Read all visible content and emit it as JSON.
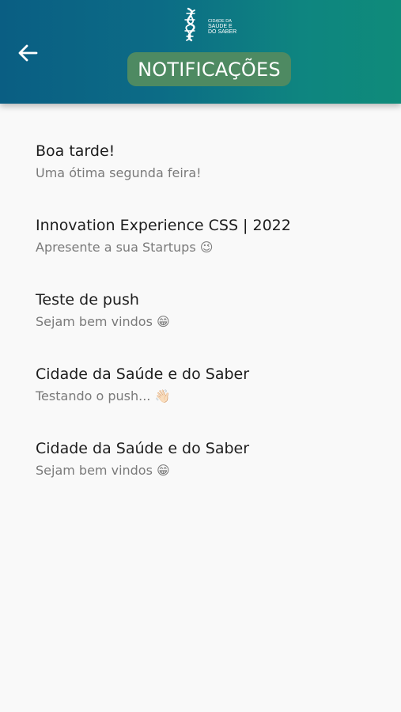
{
  "header": {
    "title": "NOTIFICAÇÕES",
    "back_icon": "arrow-left-icon",
    "logo": {
      "icon": "dna-helix-logo",
      "lines": [
        "CIDADE DA",
        "SAÚDE E",
        "DO SABER"
      ]
    },
    "colors": {
      "gradient_start": "#0a5e83",
      "gradient_end": "#0f8b7a",
      "title_pill": "#4e8a62"
    }
  },
  "notifications": [
    {
      "title": "Boa tarde!",
      "body": "Uma ótima segunda feira!"
    },
    {
      "title": "Innovation Experience CSS | 2022",
      "body": "Apresente a sua Startups 😉"
    },
    {
      "title": "Teste de push",
      "body": "Sejam bem vindos 😁"
    },
    {
      "title": "Cidade da Saúde e do Saber",
      "body": "Testando o push... 👋🏻"
    },
    {
      "title": "Cidade da Saúde e do Saber",
      "body": "Sejam bem vindos 😁"
    }
  ]
}
